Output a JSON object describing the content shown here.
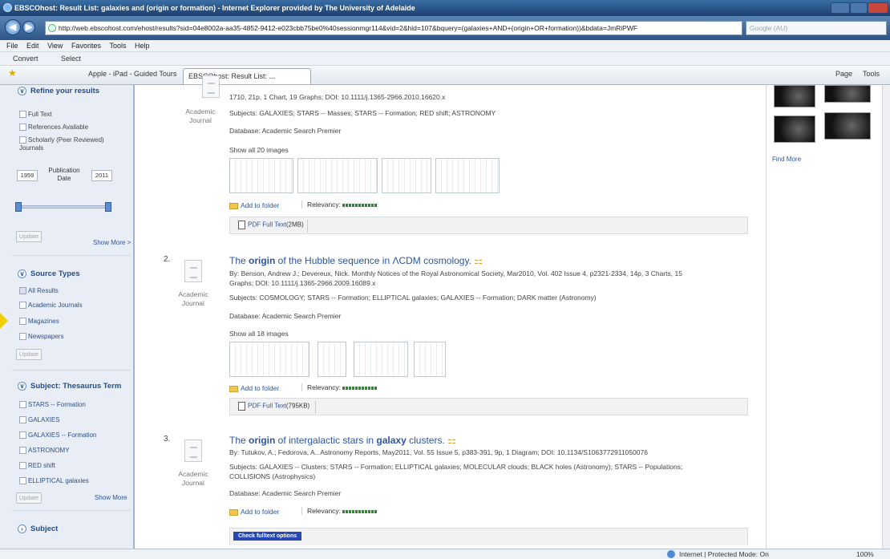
{
  "window": {
    "title": "EBSCOhost: Result List: galaxies and (origin or formation) - Internet Explorer provided by The University of Adelaide"
  },
  "address": {
    "url": "http://web.ebscohost.com/ehost/results?sid=04e8002a-aa35-4852-9412-e023cbb75be0%40sessionmgr114&vid=2&hid=107&bquery=(galaxies+AND+(origin+OR+formation))&bdata=JmRiPWF",
    "search_placeholder": "Google (AU)"
  },
  "menu": [
    "File",
    "Edit",
    "View",
    "Favorites",
    "Tools",
    "Help"
  ],
  "convert": {
    "convert": "Convert",
    "select": "Select"
  },
  "tabs": {
    "fav": "Apple - iPad - Guided Tours",
    "active": "EBSCOhost: Result List: ...",
    "page": "Page",
    "tools": "Tools"
  },
  "sidebar": {
    "refine": "Refine your results",
    "refine_opts": [
      "Full Text",
      "References Available",
      "Scholarly (Peer Reviewed) Journals"
    ],
    "year_from": "1959",
    "year_to": "2011",
    "pub_label": "Publication Date",
    "update": "Update",
    "show_more": "Show More >",
    "source_types": "Source Types",
    "source_opts": [
      "All Results",
      "Academic Journals",
      "Magazines",
      "Newspapers"
    ],
    "subject_thes": "Subject: Thesaurus Term",
    "subject_opts": [
      "STARS -- Formation",
      "GALAXIES",
      "GALAXIES -- Formation",
      "ASTRONOMY",
      "RED shift",
      "ELLIPTICAL galaxies"
    ],
    "show_more2": "Show More",
    "subject": "Subject"
  },
  "results": {
    "r1": {
      "line1": "1710, 21p, 1 Chart, 19 Graphs; DOI: 10.1111/j.1365-2966.2010.16620.x",
      "subjects": "Subjects: GALAXIES; STARS -- Masses; STARS -- Formation; RED shift; ASTRONOMY",
      "db": "Database: Academic Search Premier",
      "showimg": "Show all 20 images",
      "pdf": "PDF Full Text",
      "pdfsize": "(2MB)",
      "type": "Academic Journal"
    },
    "r2": {
      "num": "2.",
      "title_a": "The ",
      "title_b": "origin",
      "title_c": " of the Hubble sequence in ΛCDM cosmology.",
      "by": "By: Benson, Andrew J.; Devereux, Nick. Monthly Notices of the Royal Astronomical Society, Mar2010, Vol. 402 Issue 4, p2321-2334, 14p, 3 Charts, 15",
      "by2": "Graphs; DOI: 10.1111/j.1365-2966.2009.16089.x",
      "subjects": "Subjects: COSMOLOGY; STARS -- Formation; ELLIPTICAL galaxies; GALAXIES -- Formation; DARK matter (Astronomy)",
      "db": "Database: Academic Search Premier",
      "showimg": "Show all 18 images",
      "pdf": "PDF Full Text",
      "pdfsize": "(795KB)",
      "type": "Academic Journal"
    },
    "r3": {
      "num": "3.",
      "title_a": "The ",
      "title_b": "origin",
      "title_c": " of intergalactic stars in ",
      "title_d": "galaxy",
      "title_e": " clusters.",
      "by": "By: Tutukov, A.; Fedorova, A.. Astronomy Reports, May2011, Vol. 55 Issue 5, p383-391, 9p, 1 Diagram; DOI: 10.1134/S1063772911050076",
      "subjects": "Subjects: GALAXIES -- Clusters; STARS -- Formation; ELLIPTICAL galaxies; MOLECULAR clouds; BLACK holes (Astronomy); STARS -- Populations;",
      "subjects2": "COLLISIONS (Astrophysics)",
      "db": "Database: Academic Search Premier",
      "check": "Check fulltext options",
      "type": "Academic Journal"
    },
    "add_folder": "Add to folder",
    "relevancy": "Relevancy:"
  },
  "right": {
    "find_more": "Find More"
  },
  "status": {
    "zone": "Internet | Protected Mode: On",
    "zoom": "100%"
  }
}
